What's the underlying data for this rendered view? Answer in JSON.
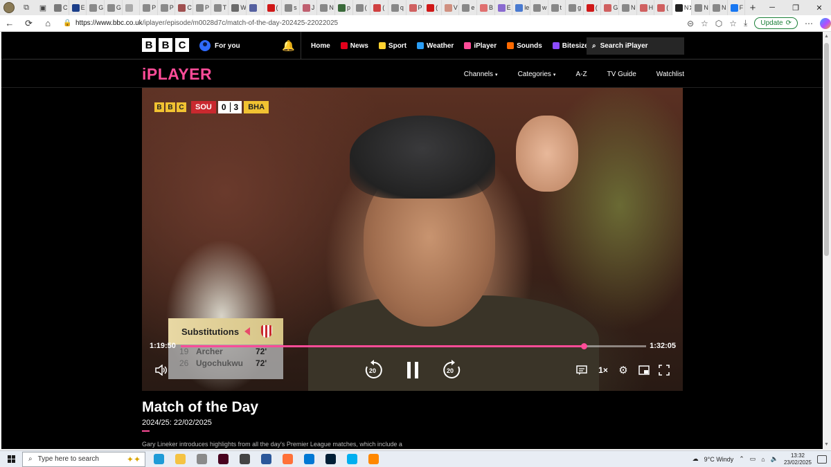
{
  "browser": {
    "tabs": [
      {
        "label": "C",
        "color": "#7a7a7a"
      },
      {
        "label": "E",
        "color": "#1c3f8a"
      },
      {
        "label": "G",
        "color": "#8a8a8a"
      },
      {
        "label": "G",
        "color": "#8a8a8a"
      },
      {
        "label": "",
        "color": "#aaaaaa"
      },
      {
        "label": "P",
        "color": "#8a8a8a"
      },
      {
        "label": "P",
        "color": "#8a8a8a"
      },
      {
        "label": "C",
        "color": "#a05050"
      },
      {
        "label": "P",
        "color": "#8a8a8a"
      },
      {
        "label": "T",
        "color": "#8a8a8a"
      },
      {
        "label": "W",
        "color": "#6a6a6a"
      },
      {
        "label": "",
        "color": "#5560a0"
      },
      {
        "label": "(",
        "color": "#d01818"
      },
      {
        "label": "s",
        "color": "#888888"
      },
      {
        "label": "J",
        "color": "#c06070"
      },
      {
        "label": "N",
        "color": "#888888"
      },
      {
        "label": "p",
        "color": "#3a6a3a"
      },
      {
        "label": "(",
        "color": "#888888"
      },
      {
        "label": "(",
        "color": "#d04040"
      },
      {
        "label": "q",
        "color": "#888888"
      },
      {
        "label": "P",
        "color": "#d06060"
      },
      {
        "label": "(",
        "color": "#d01818"
      },
      {
        "label": "V",
        "color": "#d09080"
      },
      {
        "label": "e",
        "color": "#888888"
      },
      {
        "label": "B",
        "color": "#e07070"
      },
      {
        "label": "E",
        "color": "#8a6ad0"
      },
      {
        "label": "le",
        "color": "#4a7ad0"
      },
      {
        "label": "w",
        "color": "#888888"
      },
      {
        "label": "t",
        "color": "#888888"
      },
      {
        "label": "g",
        "color": "#888888"
      },
      {
        "label": "(",
        "color": "#d01818"
      },
      {
        "label": "G",
        "color": "#d06060"
      },
      {
        "label": "N",
        "color": "#888888"
      },
      {
        "label": "H",
        "color": "#d06060"
      },
      {
        "label": "(",
        "color": "#d06060"
      }
    ],
    "active_tab": {
      "label": "N",
      "color": "#222222"
    },
    "tabs_after": [
      {
        "label": "N",
        "color": "#888888"
      },
      {
        "label": "N",
        "color": "#888888"
      },
      {
        "label": "F",
        "color": "#1877f2"
      }
    ],
    "url_host": "https://www.bbc.co.uk",
    "url_path": "/iplayer/episode/m0028d7c/match-of-the-day-202425-22022025",
    "update_label": "Update"
  },
  "bbc_header": {
    "logo_letters": [
      "B",
      "B",
      "C"
    ],
    "for_you": "For you",
    "nav": [
      {
        "label": "Home",
        "color": ""
      },
      {
        "label": "News",
        "color": "#e3001b"
      },
      {
        "label": "Sport",
        "color": "#ffd230"
      },
      {
        "label": "Weather",
        "color": "#2a9df4"
      },
      {
        "label": "iPlayer",
        "color": "#ff4c98"
      },
      {
        "label": "Sounds",
        "color": "#ff6a00"
      },
      {
        "label": "Bitesize",
        "color": "#8c4bff"
      }
    ],
    "more": "•••",
    "search_placeholder": "Search iPlayer"
  },
  "iplayer": {
    "logo": "iPLAYER",
    "subnav": [
      {
        "label": "Channels",
        "caret": "▾"
      },
      {
        "label": "Categories",
        "caret": "▾"
      },
      {
        "label": "A-Z",
        "caret": ""
      },
      {
        "label": "TV Guide",
        "caret": ""
      },
      {
        "label": "Watchlist",
        "caret": ""
      }
    ]
  },
  "video": {
    "scorebug": {
      "bbc": [
        "B",
        "B",
        "C"
      ],
      "home": "SOU",
      "home_score": "0",
      "away_score": "3",
      "away": "BHA"
    },
    "substitutions": {
      "title": "Substitutions",
      "rows": [
        {
          "num": "19",
          "name": "Archer",
          "min": "72'"
        },
        {
          "num": "26",
          "name": "Ugochukwu",
          "min": "72'"
        }
      ]
    },
    "current_time": "1:19:50",
    "total_time": "1:32:05",
    "progress": 0.866,
    "skip_back": "20",
    "skip_fwd": "20",
    "speed": "1×"
  },
  "episode": {
    "title": "Match of the Day",
    "subtitle": "2024/25: 22/02/2025",
    "description": "Gary Lineker introduces highlights from all the day's Premier League matches, which include a"
  },
  "taskbar": {
    "search_placeholder": "Type here to search",
    "apps": [
      {
        "name": "edge-app",
        "color": "#1f9bd7"
      },
      {
        "name": "explorer-app",
        "color": "#f5c343"
      },
      {
        "name": "pen-app",
        "color": "#8a8a8a"
      },
      {
        "name": "indesign-app",
        "color": "#49021f"
      },
      {
        "name": "settings-app",
        "color": "#444444"
      },
      {
        "name": "word-app",
        "color": "#2b579a"
      },
      {
        "name": "firefox-app",
        "color": "#ff7139"
      },
      {
        "name": "store-app",
        "color": "#0078d4"
      },
      {
        "name": "photoshop-app",
        "color": "#001e36"
      },
      {
        "name": "skype-app",
        "color": "#00aff0"
      },
      {
        "name": "vlc-app",
        "color": "#ff8800"
      }
    ],
    "weather": "9°C  Windy",
    "time": "13:32",
    "date": "23/02/2025"
  }
}
